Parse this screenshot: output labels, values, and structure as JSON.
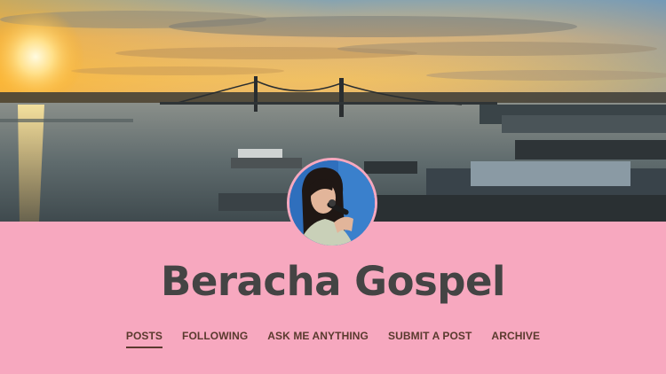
{
  "blog": {
    "title": "Beracha Gospel"
  },
  "header_image": {
    "description_icon": "harbor-sunset-photo"
  },
  "avatar": {
    "icon": "singer-portrait"
  },
  "nav": {
    "items": [
      {
        "label": "POSTS",
        "active": true
      },
      {
        "label": "FOLLOWING",
        "active": false
      },
      {
        "label": "ASK ME ANYTHING",
        "active": false
      },
      {
        "label": "SUBMIT A POST",
        "active": false
      },
      {
        "label": "ARCHIVE",
        "active": false
      }
    ]
  },
  "colors": {
    "background": "#f7a8bf",
    "title": "#444444",
    "nav_text": "#5a3a2e"
  }
}
